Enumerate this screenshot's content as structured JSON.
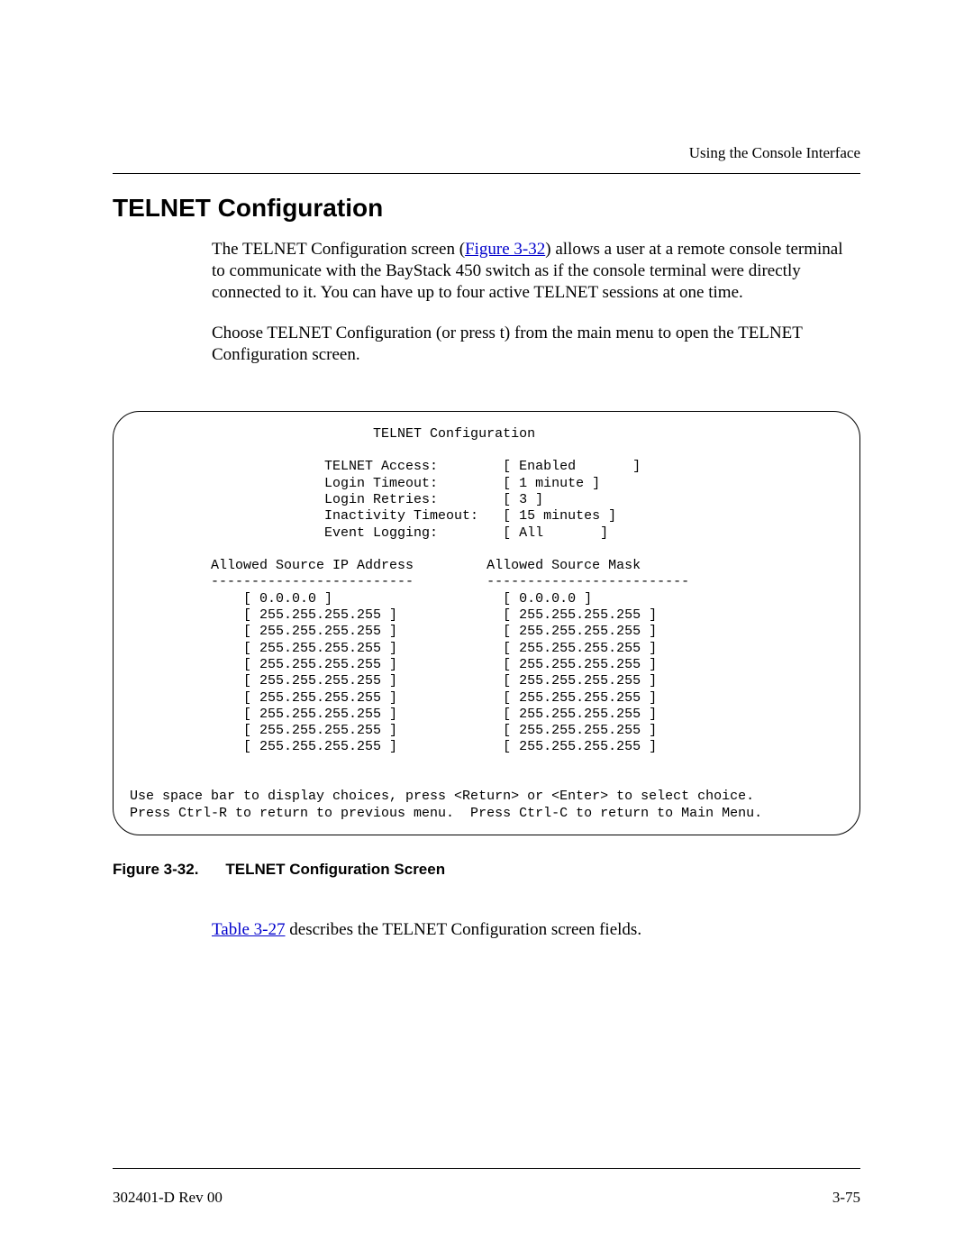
{
  "header": {
    "running": "Using the Console Interface"
  },
  "section": {
    "title": "TELNET Configuration"
  },
  "body": {
    "para1a": "The TELNET Configuration screen (",
    "para1_link": "Figure 3-32",
    "para1b": ") allows a user at a remote console terminal to communicate with the BayStack 450 switch as if the console terminal were directly connected to it. You can have up to four active TELNET sessions at one time.",
    "para2": "Choose TELNET Configuration (or press t) from the main menu to open the TELNET Configuration screen."
  },
  "screen": {
    "title": "TELNET Configuration",
    "fields": [
      {
        "label": "TELNET Access:",
        "value": "Enabled",
        "pad": 7
      },
      {
        "label": "Login Timeout:",
        "value": "1 minute",
        "pad": 1
      },
      {
        "label": "Login Retries:",
        "value": "3",
        "pad": 1
      },
      {
        "label": "Inactivity Timeout:",
        "value": "15 minutes",
        "pad": 1
      },
      {
        "label": "Event Logging:",
        "value": "All",
        "pad": 7
      }
    ],
    "col1_header": "Allowed Source IP Address",
    "col2_header": "Allowed Source Mask",
    "rows": [
      {
        "ip": "0.0.0.0",
        "mask": "0.0.0.0"
      },
      {
        "ip": "255.255.255.255",
        "mask": "255.255.255.255"
      },
      {
        "ip": "255.255.255.255",
        "mask": "255.255.255.255"
      },
      {
        "ip": "255.255.255.255",
        "mask": "255.255.255.255"
      },
      {
        "ip": "255.255.255.255",
        "mask": "255.255.255.255"
      },
      {
        "ip": "255.255.255.255",
        "mask": "255.255.255.255"
      },
      {
        "ip": "255.255.255.255",
        "mask": "255.255.255.255"
      },
      {
        "ip": "255.255.255.255",
        "mask": "255.255.255.255"
      },
      {
        "ip": "255.255.255.255",
        "mask": "255.255.255.255"
      },
      {
        "ip": "255.255.255.255",
        "mask": "255.255.255.255"
      }
    ],
    "help1": "Use space bar to display choices, press <Return> or <Enter> to select choice.",
    "help2": "Press Ctrl-R to return to previous menu.  Press Ctrl-C to return to Main Menu."
  },
  "figure": {
    "num": "Figure 3-32.",
    "caption": "TELNET Configuration Screen"
  },
  "after": {
    "link": "Table 3-27",
    "rest": " describes the TELNET Configuration screen fields."
  },
  "footer": {
    "doc": "302401-D Rev 00",
    "page": "3-75"
  }
}
